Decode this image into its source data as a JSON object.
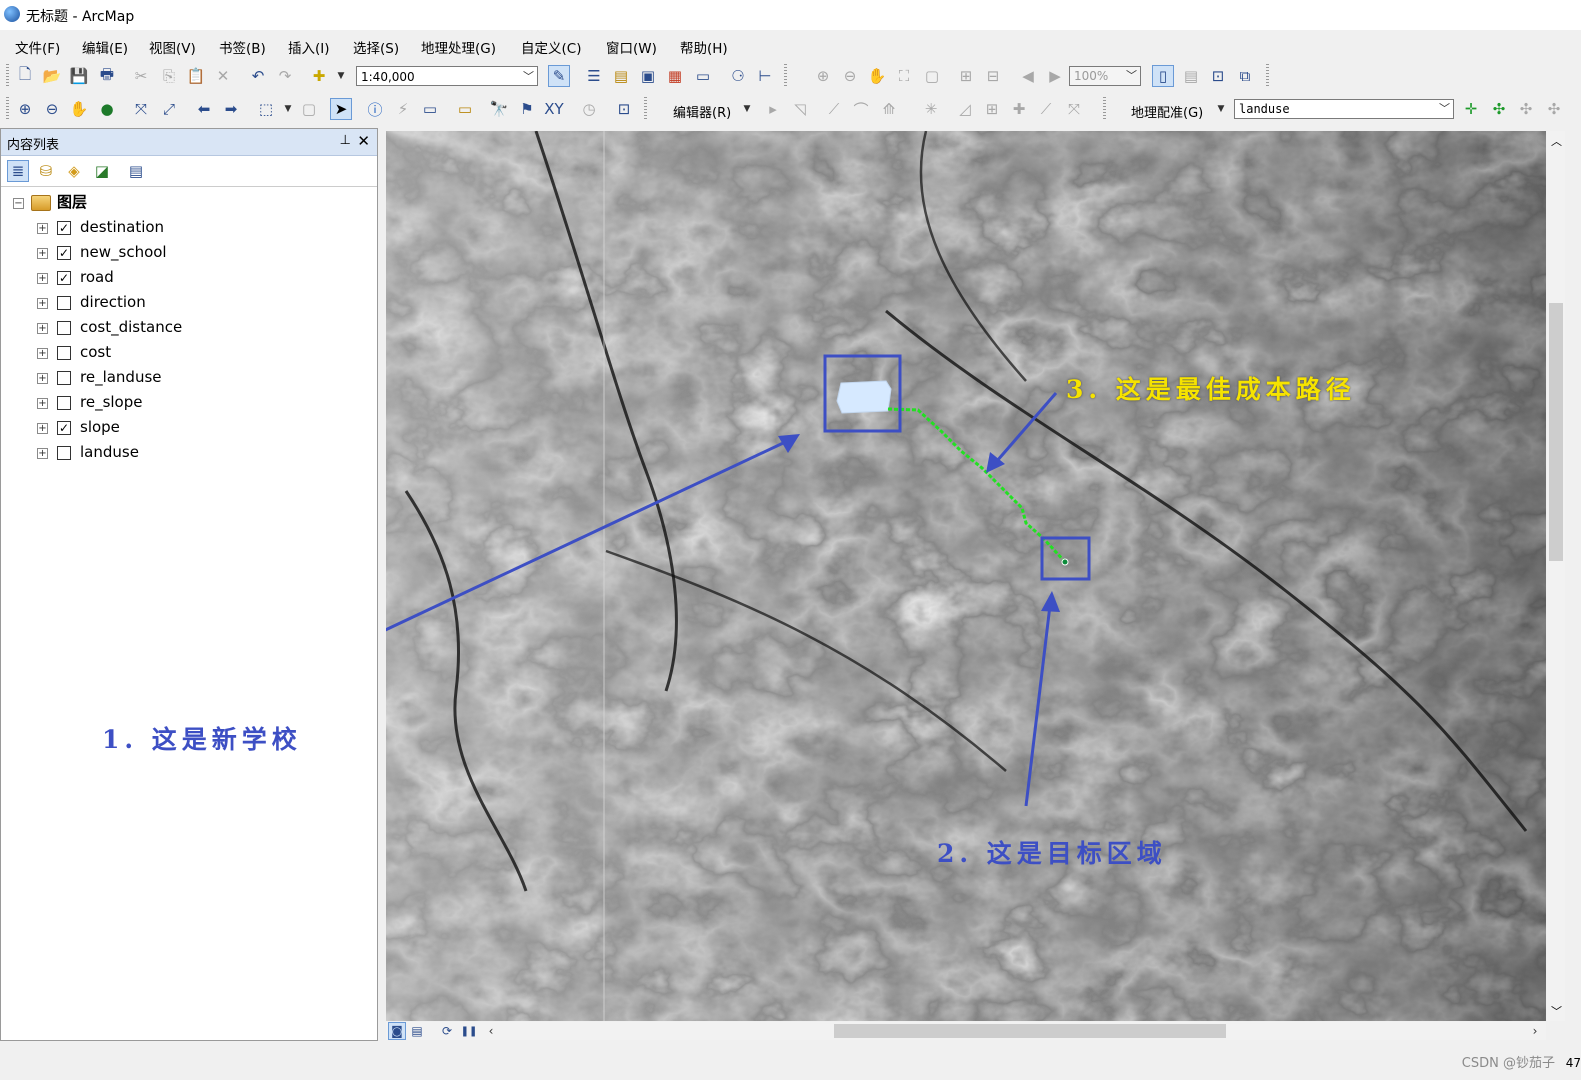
{
  "window": {
    "title": "无标题 - ArcMap"
  },
  "menu": [
    "文件(F)",
    "编辑(E)",
    "视图(V)",
    "书签(B)",
    "插入(I)",
    "选择(S)",
    "地理处理(G)",
    "自定义(C)",
    "窗口(W)",
    "帮助(H)"
  ],
  "toolbar": {
    "scale": "1:40,000",
    "zoom_percent": "100%",
    "editor_label": "编辑器(R)",
    "georef_label": "地理配准(G)",
    "georef_layer": "landuse"
  },
  "toc": {
    "title": "内容列表",
    "group_label": "图层",
    "layers": [
      {
        "name": "destination",
        "checked": true
      },
      {
        "name": "new_school",
        "checked": true
      },
      {
        "name": "road",
        "checked": true
      },
      {
        "name": "direction",
        "checked": false
      },
      {
        "name": "cost_distance",
        "checked": false
      },
      {
        "name": "cost",
        "checked": false
      },
      {
        "name": "re_landuse",
        "checked": false
      },
      {
        "name": "re_slope",
        "checked": false
      },
      {
        "name": "slope",
        "checked": true
      },
      {
        "name": "landuse",
        "checked": false
      }
    ]
  },
  "map": {
    "annotations": {
      "school": "1. 这是新学校",
      "target": "2. 这是目标区域",
      "path": "3. 这是最佳成本路径"
    },
    "colors": {
      "annotation_blue": "#3d4fc4",
      "annotation_yellow": "#f6e300",
      "path_green": "#22e022",
      "school_fill": "#d6e9ff"
    }
  },
  "statusbar": {
    "credit": "CSDN @钞茄子",
    "cut_text": "47"
  }
}
